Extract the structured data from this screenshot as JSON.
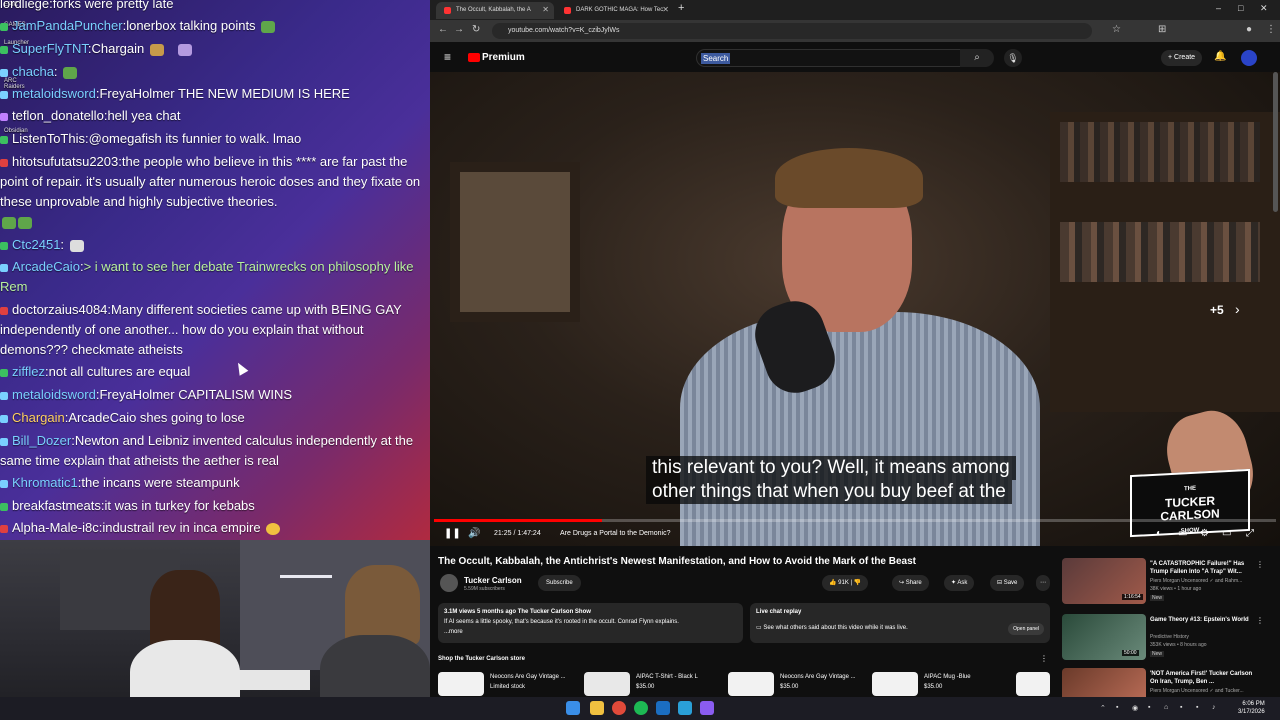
{
  "chat": {
    "launcher_labels": [
      "EPIC",
      "GAMES",
      "Launcher",
      "ARC Raiders",
      "Obsidian"
    ],
    "messages": [
      {
        "badge_color": "#e04040",
        "user": "lordliege",
        "user_color": "#ffffff",
        "text": "forks were pretty late"
      },
      {
        "badge_color": "#3cc060",
        "user": "JamPandaPuncher",
        "user_color": "#7ad0ff",
        "text": "lonerbox talking points"
      },
      {
        "badge_color": "#3cc060",
        "user": "SuperFlyTNT",
        "user_color": "#7ad0ff",
        "text": "Chargain"
      },
      {
        "badge_color": "#7ad0ff",
        "user": "chacha",
        "user_color": "#7ad0ff",
        "text": ""
      },
      {
        "badge_color": "#7ad0ff",
        "user": "metaloidsword",
        "user_color": "#7ad0ff",
        "text": "FreyaHolmer      THE NEW MEDIUM IS HERE"
      },
      {
        "badge_color": "#c080ff",
        "user": "teflon_donatello",
        "user_color": "#ffffff",
        "text": "hell yea chat"
      },
      {
        "badge_color": "#3cc060",
        "user": "ListenToThis",
        "user_color": "#ffffff",
        "text": "@omegafish its funnier to walk. lmao"
      },
      {
        "badge_color": "#e04040",
        "user": "hitotsufutatsu2203",
        "user_color": "#ffffff",
        "text": "the people who believe in this **** are far past the point of repair. it's usually after numerous heroic doses and they fixate on these unprovable and highly subjective theories."
      },
      {
        "badge_color": "#3cc060",
        "user": "Ctc2451",
        "user_color": "#7ad0ff",
        "text": ""
      },
      {
        "badge_color": "#7ad0ff",
        "user": "ArcadeCaio",
        "user_color": "#7ad0ff",
        "text": "> i want to see her debate Trainwrecks on philosophy      like Rem"
      },
      {
        "badge_color": "#e04040",
        "user": "doctorzaius4084",
        "user_color": "#ffffff",
        "text": "Many different societies came up with BEING GAY independently of one another... how do you explain that without demons??? checkmate atheists"
      },
      {
        "badge_color": "#3cc060",
        "user": "zifflez",
        "user_color": "#7ad0ff",
        "text": "not all cultures are equal"
      },
      {
        "badge_color": "#7ad0ff",
        "user": "metaloidsword",
        "user_color": "#7ad0ff",
        "text": "FreyaHolmer CAPITALISM WINS"
      },
      {
        "badge_color": "#7ad0ff",
        "user": "Chargain",
        "user_color": "#ffd060",
        "text": "ArcadeCaio shes going to lose"
      },
      {
        "badge_color": "#7ad0ff",
        "user": "Bill_Dozer",
        "user_color": "#7ad0ff",
        "text": "Newton and Leibniz invented calculus independently at the same time      explain that atheists      the aether is real"
      },
      {
        "badge_color": "#7ad0ff",
        "user": "Khromatic1",
        "user_color": "#7ad0ff",
        "text": "the incans were steampunk"
      },
      {
        "badge_color": "#3cc060",
        "user": "breakfastmeats",
        "user_color": "#ffffff",
        "text": "it was in turkey for kebabs"
      },
      {
        "badge_color": "#e04040",
        "user": "Alpha-Male-i8c",
        "user_color": "#ffffff",
        "text": "industrail rev in inca empire"
      }
    ]
  },
  "browser": {
    "tabs": [
      {
        "title": "The Occult, Kabbalah, the A",
        "active": true
      },
      {
        "title": "DARK GOTHIC MAGA: How Tec",
        "active": false
      }
    ],
    "url": "youtube.com/watch?v=K_czibJylWs",
    "window_controls": [
      "–",
      "□",
      "✕"
    ]
  },
  "youtube": {
    "logo_text": "Premium",
    "search_placeholder": "Search",
    "create_label": "Create",
    "player": {
      "caption_line1": "this relevant to you? Well, it means among",
      "caption_line2": "other things that when you buy beef at the",
      "skip_label": "+5",
      "logo_line1": "THE",
      "logo_line2": "TUCKER",
      "logo_line3": "CARLSON",
      "logo_line4": "SHOW",
      "time": "21:25 / 1:47:24",
      "chapter": "Are Drugs a Portal to the Demonic?",
      "progress": 0.2
    },
    "video": {
      "title": "The Occult, Kabbalah, the Antichrist's Newest Manifestation, and How to Avoid the Mark of the Beast",
      "channel": "Tucker Carlson",
      "subscribers": "5.59M subscribers",
      "subscribe_label": "Subscribe",
      "likes": "91K",
      "share_label": "Share",
      "ask_label": "Ask",
      "save_label": "Save",
      "views": "3.1M views  5 months ago  The Tucker Carlson Show",
      "description": "If AI seems a little spooky, that's because it's rooted in the occult. Conrad Flynn explains.",
      "more": "...more"
    },
    "live_chat": {
      "title": "Live chat replay",
      "text": "See what others said about this video while it was live.",
      "button": "Open panel"
    },
    "store": {
      "title": "Shop the Tucker Carlson store",
      "products": [
        {
          "name": "Neocons Are Gay Vintage ...",
          "price": "Limited stock"
        },
        {
          "name": "AIPAC T-Shirt - Black L",
          "price": "$35.00"
        },
        {
          "name": "Neocons Are Gay Vintage ...",
          "price": "$35.00"
        },
        {
          "name": "AIPAC Mug -Blue",
          "price": "$35.00"
        }
      ]
    },
    "recommendations": [
      {
        "title": "\"A CATASTROPHIC Failure!\" Has Trump Fallen Into \"A Trap\" Wit...",
        "channel": "Piers Morgan Uncensored ✓ and Rahm...",
        "meta": "38K views • 1 hour ago",
        "duration": "1:16:54",
        "badge": "New"
      },
      {
        "title": "Game Theory #13:  Epstein's World",
        "channel": "Predictive History",
        "meta": "353K views • 8 hours ago",
        "duration": "50:00",
        "badge": "New"
      },
      {
        "title": "'NOT America First!' Tucker Carlson On Iran, Trump, Ben ...",
        "channel": "Piers Morgan Uncensored ✓ and Tucker...",
        "meta": "",
        "duration": "",
        "badge": ""
      }
    ]
  },
  "taskbar": {
    "time": "6:06 PM",
    "date": "3/17/2026"
  }
}
